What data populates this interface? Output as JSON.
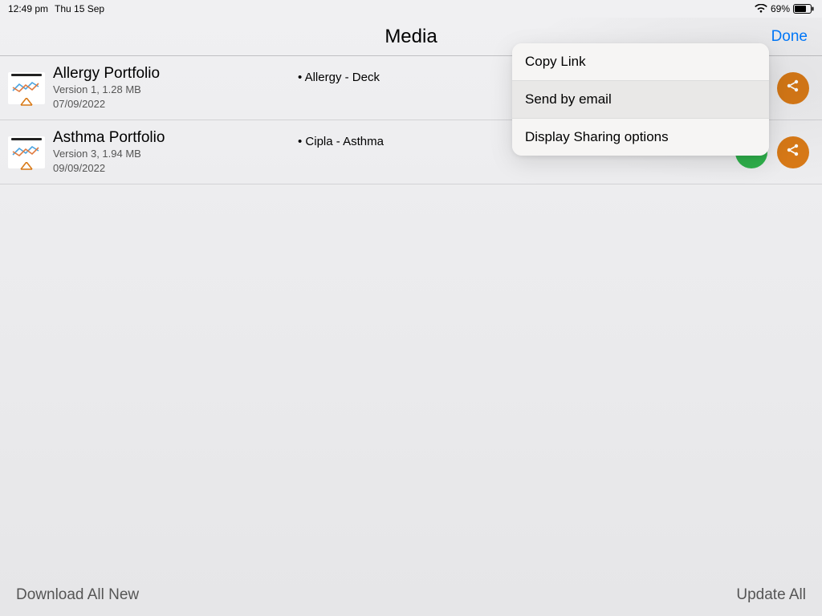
{
  "status": {
    "time": "12:49 pm",
    "date": "Thu 15 Sep",
    "battery_pct": "69%"
  },
  "header": {
    "title": "Media",
    "done_label": "Done"
  },
  "rows": [
    {
      "title": "Allergy Portfolio",
      "version_line": "Version 1, 1.28 MB",
      "date": "07/09/2022",
      "tag": "• Allergy - Deck"
    },
    {
      "title": "Asthma Portfolio",
      "version_line": "Version 3, 1.94 MB",
      "date": "09/09/2022",
      "tag": "• Cipla - Asthma"
    }
  ],
  "popover": {
    "items": [
      {
        "label": "Copy Link"
      },
      {
        "label": "Send by email"
      },
      {
        "label": "Display Sharing options"
      }
    ]
  },
  "bottom": {
    "download_all": "Download All New",
    "update_all": "Update All"
  },
  "colors": {
    "accent_blue": "#007aff",
    "share_orange": "#d97a17",
    "play_green": "#2fb24c"
  }
}
